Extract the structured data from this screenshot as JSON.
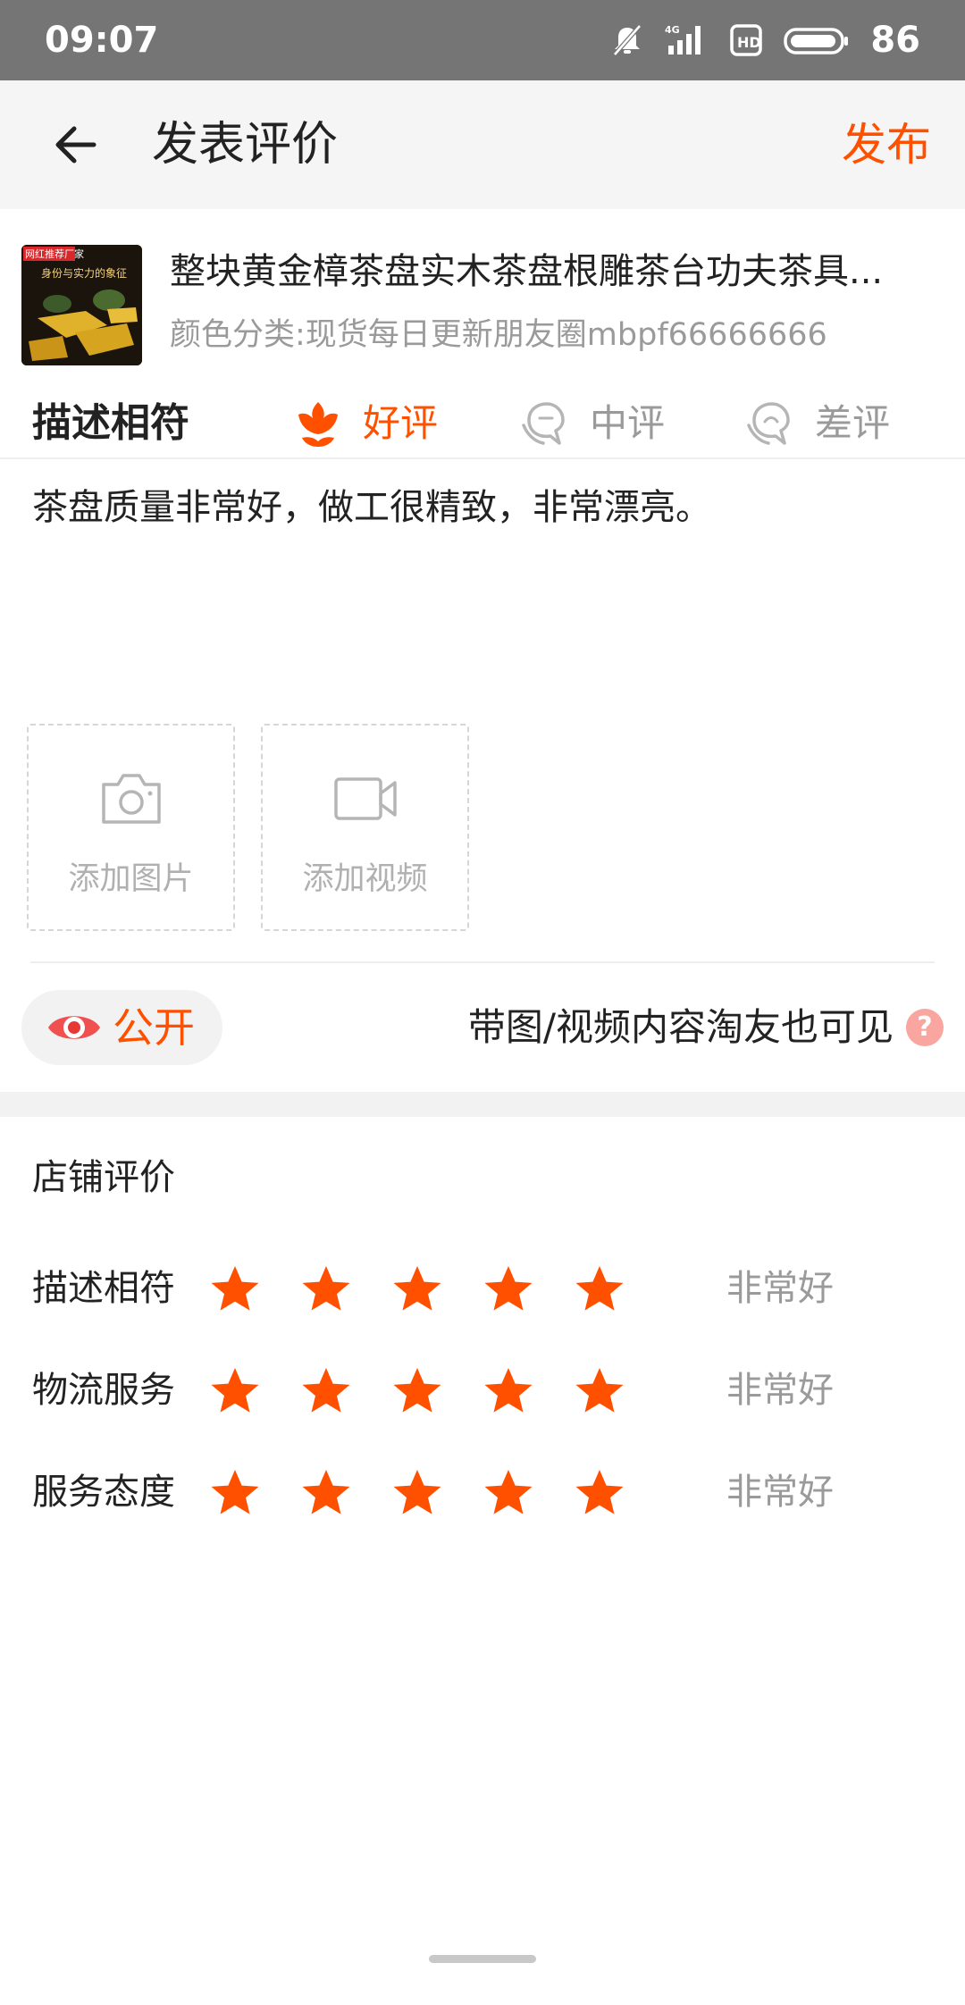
{
  "status_bar": {
    "time": "09:07",
    "network": "4G",
    "battery": "86",
    "icons": [
      "bell-off-icon",
      "signal-icon",
      "hd-icon",
      "battery-icon"
    ]
  },
  "header": {
    "back_icon": "back-arrow-icon",
    "title": "发表评价",
    "publish_label": "发布"
  },
  "product": {
    "title": "整块黄金樟茶盘实木茶盘根雕茶台功夫茶具...",
    "sku": "颜色分类:现货每日更新朋友圈mbpf66666666",
    "thumb_texts": {
      "badge": "网红推荐厂家",
      "tagline": "身份与实力的象征"
    }
  },
  "rating": {
    "label": "描述相符",
    "options": [
      {
        "label": "好评",
        "icon": "flower-icon",
        "selected": true
      },
      {
        "label": "中评",
        "icon": "neutral-face-icon",
        "selected": false
      },
      {
        "label": "差评",
        "icon": "sad-face-icon",
        "selected": false
      }
    ]
  },
  "review": {
    "text": "茶盘质量非常好，做工很精致，非常漂亮。"
  },
  "media": {
    "add_photo_label": "添加图片",
    "add_video_label": "添加视频"
  },
  "visibility": {
    "label": "公开",
    "note": "带图/视频内容淘友也可见",
    "help": "?"
  },
  "shop_rating": {
    "title": "店铺评价",
    "rows": [
      {
        "label": "描述相符",
        "stars": 5,
        "max": 5,
        "value_text": "非常好"
      },
      {
        "label": "物流服务",
        "stars": 5,
        "max": 5,
        "value_text": "非常好"
      },
      {
        "label": "服务态度",
        "stars": 5,
        "max": 5,
        "value_text": "非常好"
      }
    ]
  },
  "colors": {
    "accent": "#ff5000",
    "status_bar": "#757575",
    "muted_text": "#9a9a9a"
  }
}
